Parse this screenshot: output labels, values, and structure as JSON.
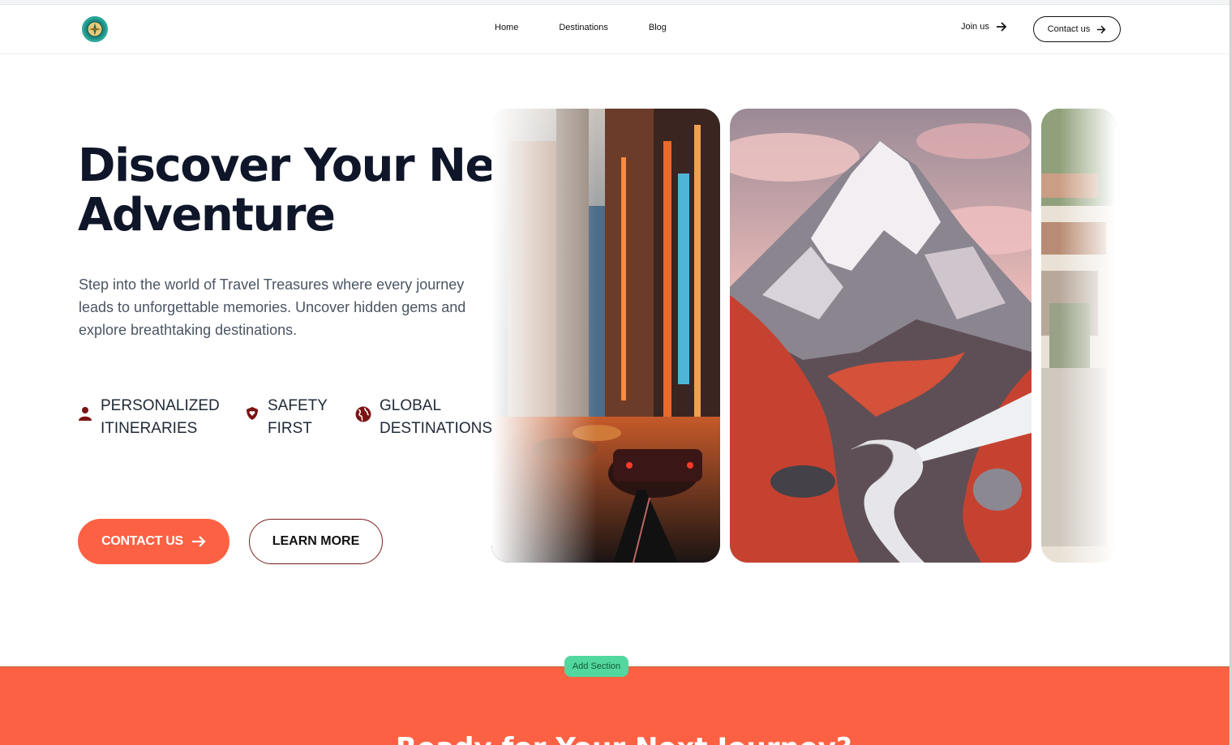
{
  "header": {
    "logo_icon": "compass-icon",
    "nav": [
      {
        "label": "Home"
      },
      {
        "label": "Destinations"
      },
      {
        "label": "Blog"
      }
    ],
    "join_label": "Join us",
    "contact_label": "Contact us"
  },
  "hero": {
    "title": "Discover Your Next Adventure",
    "lead": "Step into the world of Travel Treasures where every journey leads to unforgettable memories. Uncover hidden gems and explore breathtaking destinations.",
    "features": [
      {
        "icon": "user-icon",
        "label": "PERSONALIZED ITINERARIES"
      },
      {
        "icon": "shield-heart-icon",
        "label": "SAFETY FIRST"
      },
      {
        "icon": "globe-icon",
        "label": "GLOBAL DESTINATIONS"
      }
    ],
    "primary_button": "CONTACT US",
    "secondary_button": "LEARN MORE"
  },
  "editor": {
    "add_section_label": "Add Section"
  },
  "next_section": {
    "title": "Ready for Your Next Journey?"
  },
  "colors": {
    "accent": "#fd6143",
    "dark_red": "#7c1f1f",
    "heading": "#0f1629",
    "add_section_bg": "#52d79f"
  }
}
